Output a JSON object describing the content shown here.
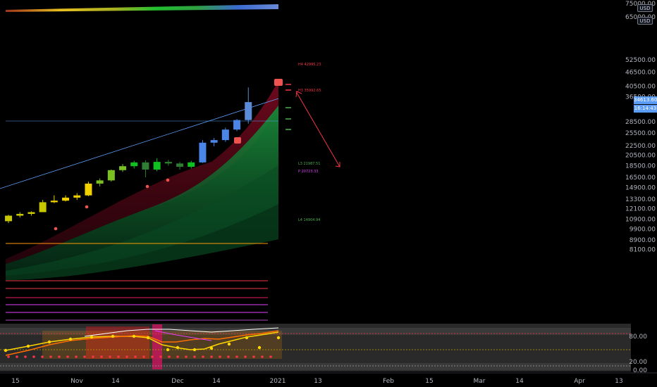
{
  "currency": "USD",
  "price_axis": {
    "scale": "log",
    "top_label": "75000.00",
    "second_label": "65000.00",
    "labels": [
      "52500.00",
      "46500.00",
      "40500.00",
      "36500.00",
      "28500.00",
      "25500.00",
      "22500.00",
      "20500.00",
      "18500.00",
      "16500.00",
      "14900.00",
      "13300.00",
      "12100.00",
      "10900.00",
      "9900.00",
      "8900.00",
      "8100.00"
    ]
  },
  "last_price": "34613.60",
  "countdown": "16:14:43",
  "oscillator_axis": {
    "labels": [
      "80.00",
      "20.00",
      "0.00"
    ],
    "range": [
      0,
      100
    ]
  },
  "time_axis": {
    "labels": [
      "15",
      "Nov",
      "14",
      "Dec",
      "14",
      "2021",
      "13",
      "Feb",
      "15",
      "Mar",
      "14",
      "Apr",
      "13"
    ]
  },
  "pivots": {
    "H4": "H4 42995.23",
    "H3": "H3 35992.65",
    "L3": "L3 21987.51",
    "P": "P 20723.33",
    "L4": "L4 14904.94"
  },
  "colors": {
    "up": "#26a69a",
    "accent_blue": "#5b9cf6",
    "resistance": "#f23645",
    "support": "#4caf50",
    "pivot": "#e040fb",
    "band_top": "#8b0a2a",
    "band_bottom": "#0b5a2a"
  },
  "chart_data": {
    "type": "candlestick",
    "y_scale": "log",
    "ylim": [
      7500,
      75000
    ],
    "x_range": [
      "Oct 8 2020",
      "Apr 20 2021"
    ],
    "candles_weekly_approx": [
      {
        "date": "2020-10-09",
        "open": 10700,
        "high": 11400,
        "low": 10500,
        "close": 11300
      },
      {
        "date": "2020-10-13",
        "open": 11300,
        "high": 11700,
        "low": 11100,
        "close": 11500
      },
      {
        "date": "2020-10-17",
        "open": 11500,
        "high": 11800,
        "low": 11300,
        "close": 11700
      },
      {
        "date": "2020-10-21",
        "open": 11700,
        "high": 13200,
        "low": 11700,
        "close": 12900
      },
      {
        "date": "2020-10-25",
        "open": 12900,
        "high": 13800,
        "low": 12800,
        "close": 13100
      },
      {
        "date": "2020-10-29",
        "open": 13100,
        "high": 13800,
        "low": 13000,
        "close": 13500
      },
      {
        "date": "2020-11-02",
        "open": 13500,
        "high": 14100,
        "low": 13200,
        "close": 13800
      },
      {
        "date": "2020-11-06",
        "open": 13800,
        "high": 15800,
        "low": 13700,
        "close": 15500
      },
      {
        "date": "2020-11-10",
        "open": 15500,
        "high": 16300,
        "low": 15100,
        "close": 16000
      },
      {
        "date": "2020-11-14",
        "open": 16000,
        "high": 17800,
        "low": 15800,
        "close": 17700
      },
      {
        "date": "2020-11-18",
        "open": 17700,
        "high": 18800,
        "low": 17400,
        "close": 18400
      },
      {
        "date": "2020-11-22",
        "open": 18400,
        "high": 19400,
        "low": 18000,
        "close": 19100
      },
      {
        "date": "2020-11-26",
        "open": 19100,
        "high": 19500,
        "low": 16500,
        "close": 17800
      },
      {
        "date": "2020-11-30",
        "open": 17800,
        "high": 19900,
        "low": 17500,
        "close": 19200
      },
      {
        "date": "2020-12-04",
        "open": 19200,
        "high": 19600,
        "low": 18500,
        "close": 18900
      },
      {
        "date": "2020-12-08",
        "open": 18900,
        "high": 19200,
        "low": 17800,
        "close": 18300
      },
      {
        "date": "2020-12-12",
        "open": 18300,
        "high": 19400,
        "low": 18000,
        "close": 19100
      },
      {
        "date": "2020-12-16",
        "open": 19100,
        "high": 23800,
        "low": 19000,
        "close": 23200
      },
      {
        "date": "2020-12-20",
        "open": 23200,
        "high": 24300,
        "low": 22400,
        "close": 23800
      },
      {
        "date": "2020-12-24",
        "open": 23800,
        "high": 26900,
        "low": 23400,
        "close": 26400
      },
      {
        "date": "2020-12-28",
        "open": 26400,
        "high": 29300,
        "low": 26000,
        "close": 29000
      },
      {
        "date": "2021-01-01",
        "open": 29000,
        "high": 40000,
        "low": 28000,
        "close": 34613.6
      }
    ],
    "pivot_levels": {
      "H4": 42995.23,
      "H3": 35992.65,
      "P": 20723.33,
      "L3": 21987.51,
      "L4": 14904.94
    },
    "horizontal_levels": [
      12900,
      10000
    ],
    "oscillator": {
      "range": [
        0,
        100
      ],
      "levels": [
        80,
        50,
        20,
        0
      ]
    }
  }
}
